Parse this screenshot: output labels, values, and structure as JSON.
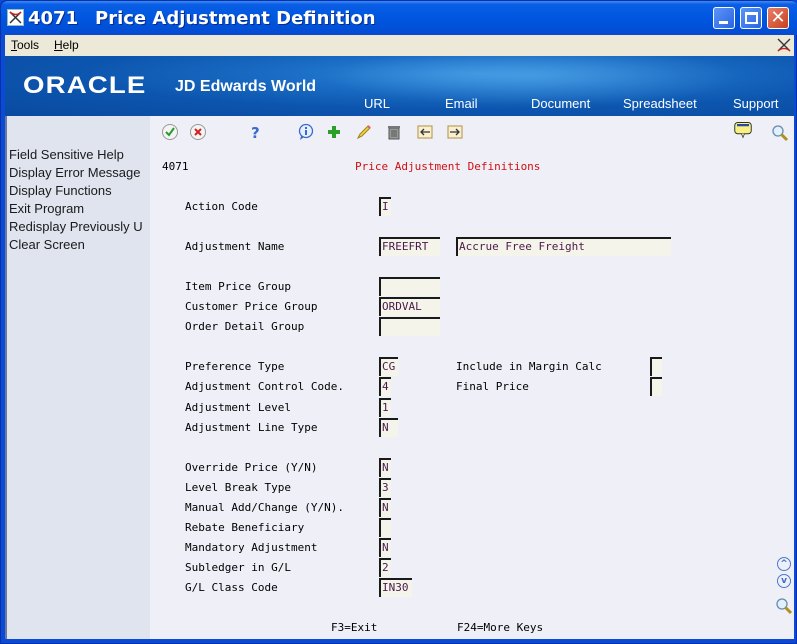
{
  "window": {
    "program_code": "4071",
    "title": "Price Adjustment Definition",
    "controls": [
      "minimize",
      "maximize",
      "close"
    ]
  },
  "menubar": {
    "items": [
      {
        "label": "Tools",
        "accel": "T"
      },
      {
        "label": "Help",
        "accel": "H"
      }
    ]
  },
  "banner": {
    "brand": "ORACLE",
    "product": "JD Edwards World",
    "links": [
      "URL",
      "Email",
      "Document",
      "Spreadsheet",
      "Support"
    ]
  },
  "toolbar": {
    "icons": [
      "check-icon",
      "cancel-icon",
      "help-icon",
      "info-icon",
      "add-icon",
      "edit-icon",
      "delete-icon",
      "import-icon",
      "export-icon"
    ],
    "right_icons": [
      "message-icon",
      "search-icon"
    ]
  },
  "sidebar": {
    "items": [
      "Field Sensitive Help",
      "Display Error Message",
      "Display Functions",
      "Exit Program",
      "Redisplay Previously U",
      "Clear Screen"
    ]
  },
  "form": {
    "code": "4071",
    "title": "Price Adjustment Definitions",
    "fields": {
      "action_code": {
        "label": "Action Code",
        "value": "I"
      },
      "adjustment_name": {
        "label": "Adjustment Name",
        "value": "FREEFRT",
        "description": "Accrue Free Freight"
      },
      "item_price_group": {
        "label": "Item Price Group",
        "value": ""
      },
      "customer_price_group": {
        "label": "Customer Price Group",
        "value": "ORDVAL"
      },
      "order_detail_group": {
        "label": "Order Detail Group",
        "value": ""
      },
      "preference_type": {
        "label": "Preference Type",
        "value": "CG"
      },
      "adjustment_control_code": {
        "label": "Adjustment Control Code.",
        "value": "4"
      },
      "adjustment_level": {
        "label": "Adjustment Level",
        "value": "1"
      },
      "adjustment_line_type": {
        "label": "Adjustment Line Type",
        "value": "N"
      },
      "include_in_margin_calc": {
        "label": "Include in Margin Calc",
        "value": ""
      },
      "final_price": {
        "label": "Final Price",
        "value": ""
      },
      "override_price": {
        "label": "Override Price (Y/N)",
        "value": "N"
      },
      "level_break_type": {
        "label": "Level Break Type",
        "value": "3"
      },
      "manual_add_change": {
        "label": "Manual Add/Change (Y/N).",
        "value": "N"
      },
      "rebate_beneficiary": {
        "label": "Rebate Beneficiary",
        "value": ""
      },
      "mandatory_adjustment": {
        "label": "Mandatory Adjustment",
        "value": "N"
      },
      "subledger_in_gl": {
        "label": "Subledger in G/L",
        "value": "2"
      },
      "gl_class_code": {
        "label": "G/L Class Code",
        "value": "IN30"
      }
    }
  },
  "function_keys": [
    "F3=Exit",
    "F24=More Keys"
  ]
}
